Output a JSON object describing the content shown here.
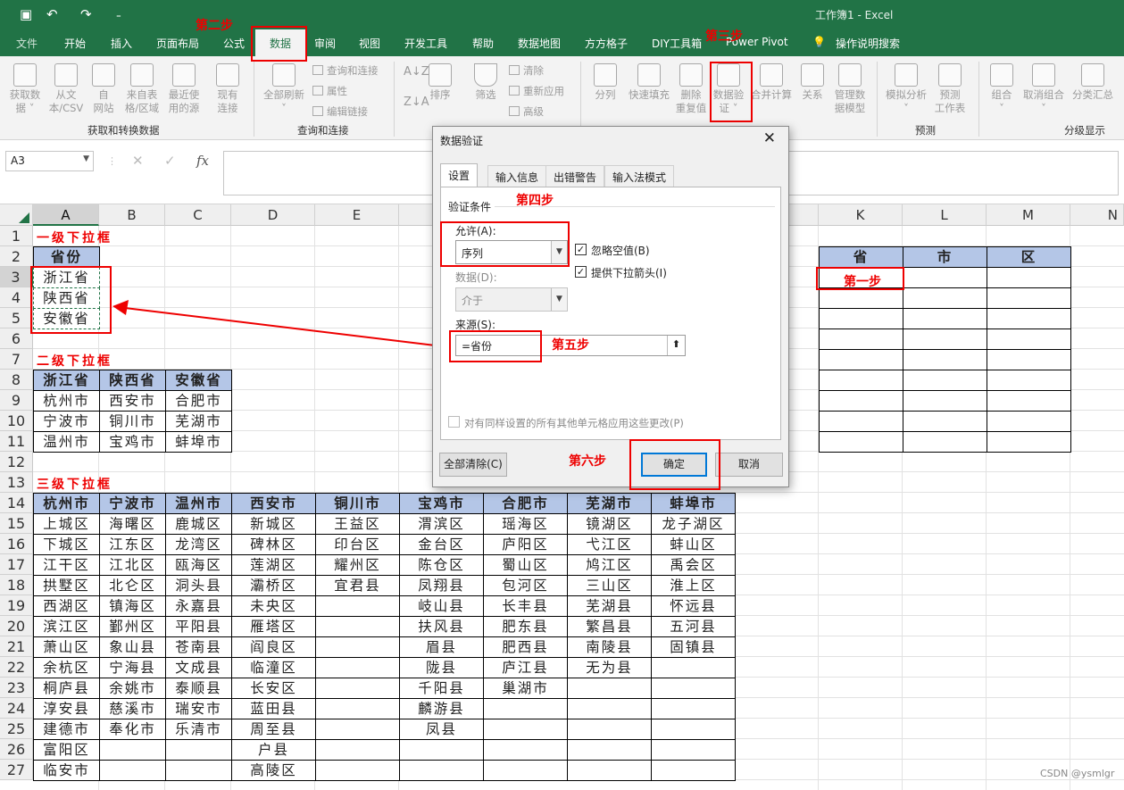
{
  "window": {
    "title": "工作簿1  -  Excel",
    "qa_icons": [
      "save-icon",
      "undo-icon",
      "redo-icon",
      "customize-icon"
    ]
  },
  "tabs": [
    "文件",
    "开始",
    "插入",
    "页面布局",
    "公式",
    "数据",
    "审阅",
    "视图",
    "开发工具",
    "帮助",
    "数据地图",
    "方方格子",
    "DIY工具箱",
    "Power Pivot"
  ],
  "tell_me": "操作说明搜索",
  "ribbon": {
    "get": {
      "get_data": "获取数\n据 ˅",
      "from_text": "从文\n本/CSV",
      "from_web": "自\n网站",
      "from_table": "来自表\n格/区域",
      "recent": "最近使\n用的源",
      "existing": "现有\n连接",
      "group": "获取和转换数据"
    },
    "query": {
      "refresh": "全部刷新\n˅",
      "conn": "查询和连接",
      "props": "属性",
      "edit_links": "编辑链接",
      "group": "查询和连接"
    },
    "sort": {
      "sort": "排序"
    },
    "filter": {
      "filter": "筛选",
      "clear": "清除",
      "reapply": "重新应用",
      "advanced": "高级"
    },
    "tools": {
      "split": "分列",
      "flash": "快速填充",
      "remove_dup": "删除\n重复值",
      "validation": "数据验\n证 ˅",
      "consolidate": "合并计算",
      "relation": "关系",
      "model": "管理数\n据模型"
    },
    "forecast": {
      "whatif": "模拟分析\n˅",
      "sheet": "预测\n工作表",
      "group": "预测"
    },
    "outline": {
      "group_btn": "组合\n˅",
      "ungroup": "取消组合\n˅",
      "subtotal": "分类汇总",
      "group": "分级显示"
    }
  },
  "formula_bar": {
    "namebox": "A3",
    "fx": "fx"
  },
  "columns": [
    {
      "name": "A"
    },
    {
      "name": "B"
    },
    {
      "name": "C"
    },
    {
      "name": "D"
    },
    {
      "name": "E"
    },
    {
      "name": "K"
    },
    {
      "name": "L"
    },
    {
      "name": "M"
    },
    {
      "name": "N"
    }
  ],
  "rows": [
    "1",
    "2",
    "3",
    "4",
    "5",
    "6",
    "7",
    "8",
    "9",
    "10",
    "11",
    "12",
    "13",
    "14",
    "15",
    "16",
    "17",
    "18",
    "19",
    "20",
    "21",
    "22",
    "23",
    "24",
    "25",
    "26",
    "27"
  ],
  "sheet": {
    "label1": "一级下拉框",
    "provinces_header": "省份",
    "provinces": [
      "浙江省",
      "陕西省",
      "安徽省"
    ],
    "label2": "二级下拉框",
    "level2_headers": [
      "浙江省",
      "陕西省",
      "安徽省"
    ],
    "level2_rows": [
      [
        "杭州市",
        "西安市",
        "合肥市"
      ],
      [
        "宁波市",
        "铜川市",
        "芜湖市"
      ],
      [
        "温州市",
        "宝鸡市",
        "蚌埠市"
      ]
    ],
    "label3": "三级下拉框",
    "level3_headers": [
      "杭州市",
      "宁波市",
      "温州市",
      "西安市",
      "铜川市",
      "宝鸡市",
      "合肥市",
      "芜湖市",
      "蚌埠市"
    ],
    "level3_rows": [
      [
        "上城区",
        "海曙区",
        "鹿城区",
        "新城区",
        "王益区",
        "渭滨区",
        "瑶海区",
        "镜湖区",
        "龙子湖区"
      ],
      [
        "下城区",
        "江东区",
        "龙湾区",
        "碑林区",
        "印台区",
        "金台区",
        "庐阳区",
        "弋江区",
        "蚌山区"
      ],
      [
        "江干区",
        "江北区",
        "瓯海区",
        "莲湖区",
        "耀州区",
        "陈仓区",
        "蜀山区",
        "鸠江区",
        "禹会区"
      ],
      [
        "拱墅区",
        "北仑区",
        "洞头县",
        "灞桥区",
        "宜君县",
        "凤翔县",
        "包河区",
        "三山区",
        "淮上区"
      ],
      [
        "西湖区",
        "镇海区",
        "永嘉县",
        "未央区",
        "",
        "岐山县",
        "长丰县",
        "芜湖县",
        "怀远县"
      ],
      [
        "滨江区",
        "鄞州区",
        "平阳县",
        "雁塔区",
        "",
        "扶风县",
        "肥东县",
        "繁昌县",
        "五河县"
      ],
      [
        "萧山区",
        "象山县",
        "苍南县",
        "阎良区",
        "",
        "眉县",
        "肥西县",
        "南陵县",
        "固镇县"
      ],
      [
        "余杭区",
        "宁海县",
        "文成县",
        "临潼区",
        "",
        "陇县",
        "庐江县",
        "无为县",
        ""
      ],
      [
        "桐庐县",
        "余姚市",
        "泰顺县",
        "长安区",
        "",
        "千阳县",
        "巢湖市",
        "",
        ""
      ],
      [
        "淳安县",
        "慈溪市",
        "瑞安市",
        "蓝田县",
        "",
        "麟游县",
        "",
        "",
        ""
      ],
      [
        "建德市",
        "奉化市",
        "乐清市",
        "周至县",
        "",
        "凤县",
        "",
        "",
        ""
      ],
      [
        "富阳区",
        "",
        "",
        "户县",
        "",
        "",
        "",
        "",
        ""
      ],
      [
        "临安市",
        "",
        "",
        "高陵区",
        "",
        "",
        "",
        "",
        ""
      ]
    ],
    "right_headers": [
      "省",
      "市",
      "区"
    ]
  },
  "annotations": {
    "step1": "第一步",
    "step2": "第二步",
    "step3": "第三步",
    "step4": "第四步",
    "step5": "第五步",
    "step6": "第六步"
  },
  "dialog": {
    "title": "数据验证",
    "close": "✕",
    "tabs": [
      "设置",
      "输入信息",
      "出错警告",
      "输入法模式"
    ],
    "criteria": "验证条件",
    "allow_label": "允许(A):",
    "allow_value": "序列",
    "ignore_blank": "忽略空值(B)",
    "dropdown": "提供下拉箭头(I)",
    "data_label": "数据(D):",
    "data_value": "介于",
    "source_label": "来源(S):",
    "source_value": "=省份",
    "apply_all": "对有同样设置的所有其他单元格应用这些更改(P)",
    "clear_all": "全部清除(C)",
    "ok": "确定",
    "cancel": "取消"
  },
  "watermark": "CSDN @ysmlgr"
}
